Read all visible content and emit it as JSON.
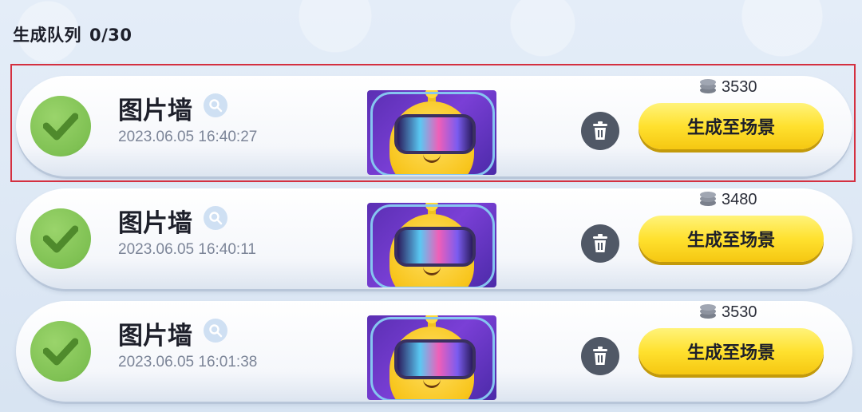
{
  "header": {
    "title": "生成队列",
    "count": "0/30"
  },
  "colors": {
    "accent_yellow": "#ffe12f",
    "check_green": "#7fc153",
    "selection_red": "#d43040"
  },
  "items": [
    {
      "title": "图片墙",
      "time": "2023.06.05 16:40:27",
      "cost": "3530",
      "button": "生成至场景",
      "selected": true
    },
    {
      "title": "图片墙",
      "time": "2023.06.05 16:40:11",
      "cost": "3480",
      "button": "生成至场景",
      "selected": false
    },
    {
      "title": "图片墙",
      "time": "2023.06.05 16:01:38",
      "cost": "3530",
      "button": "生成至场景",
      "selected": false
    }
  ],
  "icons": [
    "check-icon",
    "search-icon",
    "trash-icon",
    "coin-icon"
  ]
}
